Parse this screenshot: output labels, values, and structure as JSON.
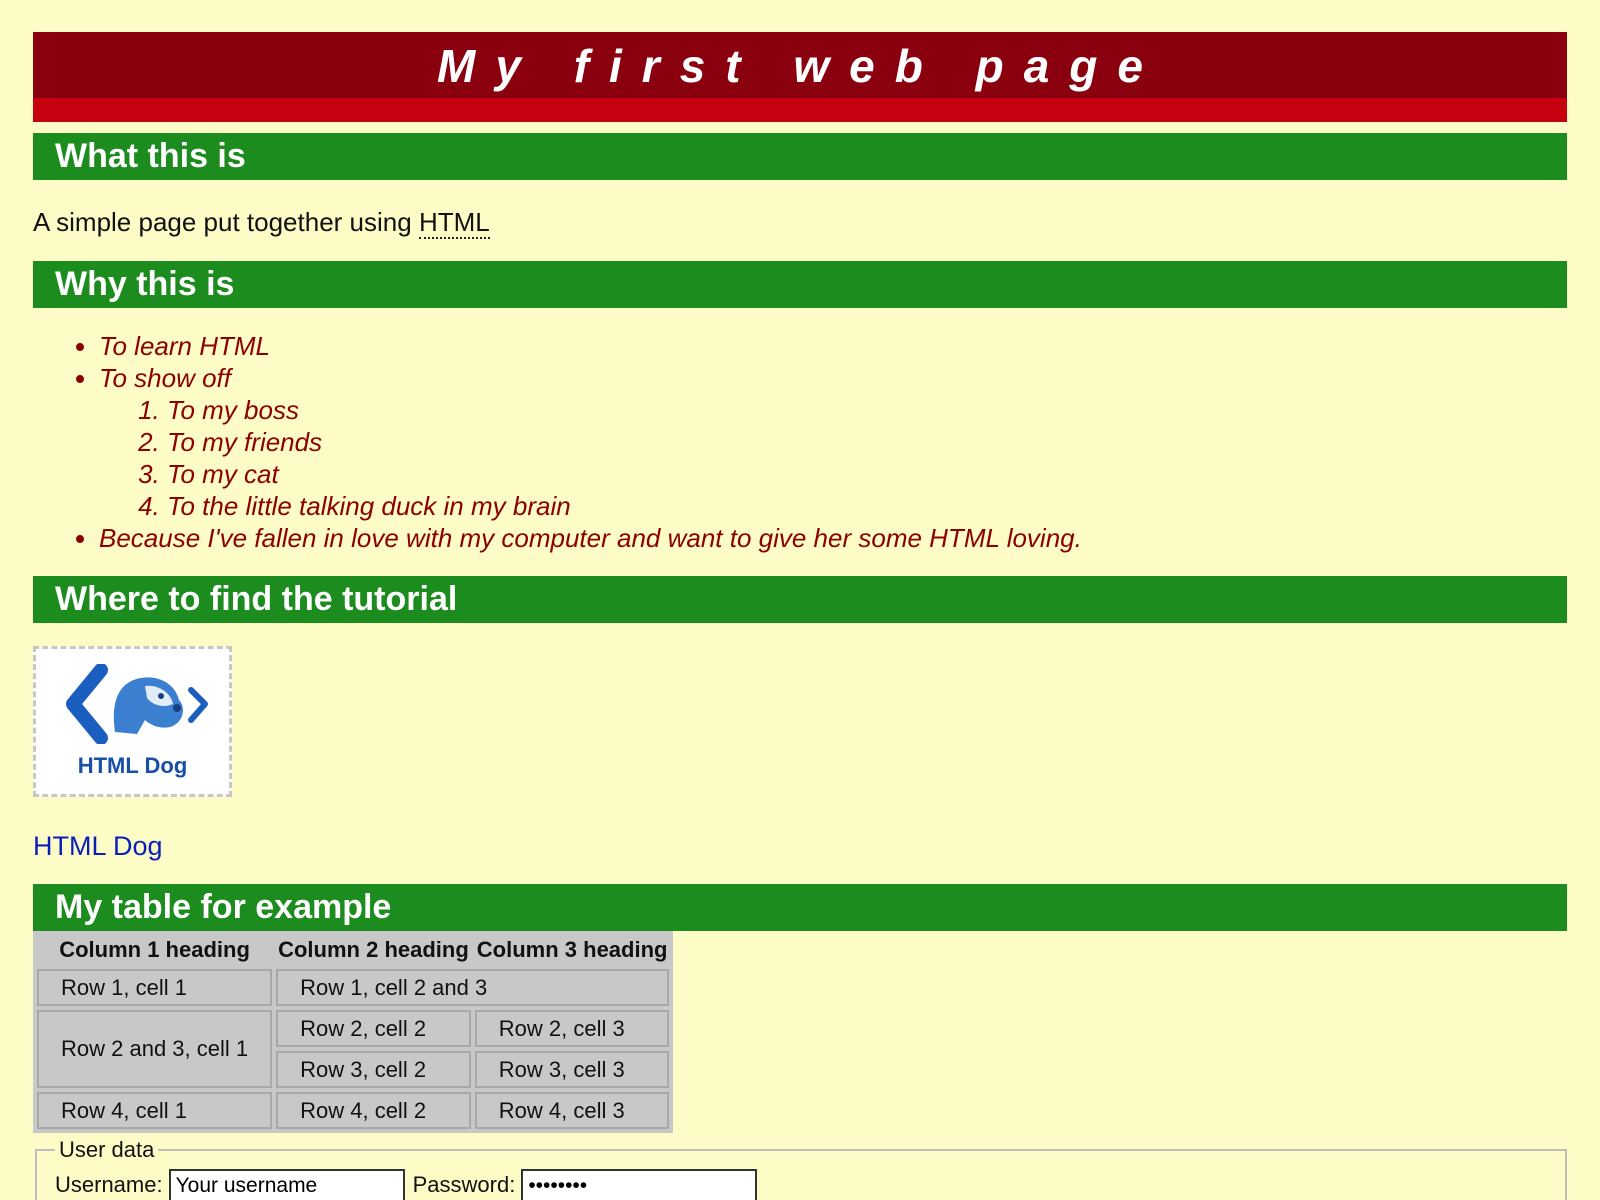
{
  "banner": {
    "title": "My first web page"
  },
  "sections": {
    "what": {
      "heading": "What this is",
      "text_before": "A simple page put together using ",
      "abbr": "HTML"
    },
    "why": {
      "heading": "Why this is",
      "items": [
        {
          "text": "To learn HTML"
        },
        {
          "text": "To show off",
          "subitems": [
            "To my boss",
            "To my friends",
            "To my cat",
            "To the little talking duck in my brain"
          ]
        },
        {
          "text": "Because I've fallen in love with my computer and want to give her some HTML loving."
        }
      ]
    },
    "where": {
      "heading": "Where to find the tutorial",
      "logo_text": "HTML Dog",
      "link_text": "HTML Dog"
    },
    "table": {
      "heading": "My table for example",
      "headers": [
        "Column 1 heading",
        "Column 2 heading",
        "Column 3 heading"
      ],
      "r1c1": "Row 1, cell 1",
      "r1c23": "Row 1, cell 2 and 3",
      "r23c1": "Row 2 and 3, cell 1",
      "r2c2": "Row 2, cell 2",
      "r2c3": "Row 2, cell 3",
      "r3c2": "Row 3, cell 2",
      "r3c3": "Row 3, cell 3",
      "r4c1": "Row 4, cell 1",
      "r4c2": "Row 4, cell 2",
      "r4c3": "Row 4, cell 3"
    }
  },
  "form": {
    "legend": "User data",
    "username_label": "Username:",
    "username_value": "Your username",
    "password_label": "Password:",
    "password_value": "password"
  },
  "colors": {
    "background": "#fefcc6",
    "banner": "#8b000f",
    "banner_stripe": "#c6000f",
    "section": "#1d8c1e",
    "list_text": "#8b0000",
    "link": "#0a1fb8"
  }
}
